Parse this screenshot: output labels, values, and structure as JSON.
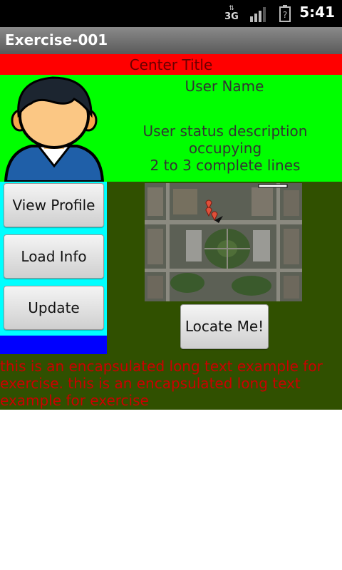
{
  "status_bar": {
    "network_type": "3G",
    "time": "5:41",
    "battery_symbol": "?"
  },
  "app": {
    "title": "Exercise-001"
  },
  "header": {
    "center_title": "Center Title"
  },
  "profile": {
    "user_name": "User Name",
    "status_line1": "User status description occupying",
    "status_line2": "2 to 3 complete lines"
  },
  "buttons": {
    "view_profile": "View Profile",
    "load_info": "Load Info",
    "update": "Update",
    "locate_me": "Locate Me!"
  },
  "long_text": "this is an encapsulated long text example for exercise. this is an encapsulated long text example for exercise",
  "colors": {
    "center_title_bg": "#ff0000",
    "profile_bg": "#00ff00",
    "left_panel_bg": "#00ffff",
    "blue_bar_bg": "#0000ff",
    "map_area_bg": "#305000",
    "long_text": "#cc0000"
  },
  "icons": {
    "avatar": "user-avatar-icon",
    "signal": "signal-strength-icon",
    "battery": "battery-icon",
    "data": "3g-data-icon"
  }
}
